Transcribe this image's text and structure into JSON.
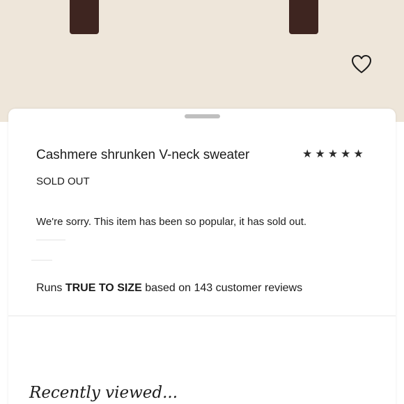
{
  "product": {
    "title": "Cashmere shrunken V-neck sweater",
    "rating_stars": "★★★★★",
    "rating": 4.5,
    "status": "SOLD OUT",
    "sold_out_message": "We're sorry. This item has been so popular, it has sold out."
  },
  "fit": {
    "prefix": "Runs",
    "emphasis": "TRUE TO SIZE",
    "suffix": "based on 143 customer reviews"
  },
  "recently_viewed": {
    "heading": "Recently viewed..."
  },
  "icons": {
    "favorite": "heart-outline-icon"
  },
  "colors": {
    "hero_background": "#eee6da",
    "garment": "#3e2520",
    "text": "#1c1c1c"
  }
}
